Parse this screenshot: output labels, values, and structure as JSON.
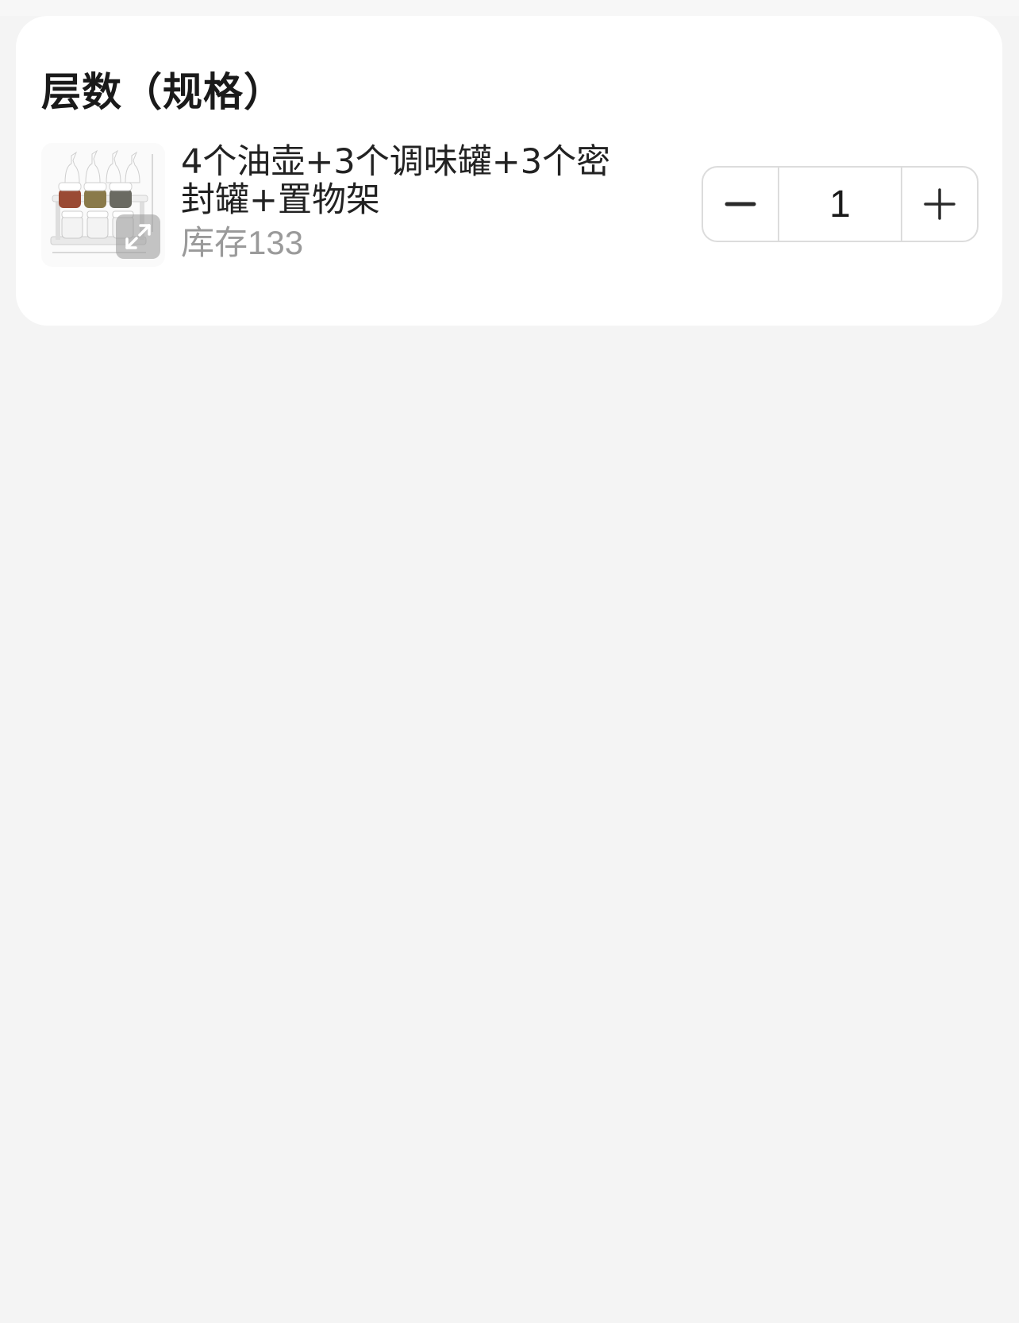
{
  "section": {
    "title": "层数（规格）"
  },
  "sku": {
    "name": "4个油壶+3个调味罐+3个密封罐+置物架",
    "stock_label": "库存",
    "stock_count": "133",
    "image_icon": "product-thumbnail",
    "expand_icon": "expand-arrows-icon"
  },
  "stepper": {
    "decrement_icon": "minus-icon",
    "value": "1",
    "increment_icon": "plus-icon"
  },
  "colors": {
    "background": "#f4f4f4",
    "card": "#ffffff",
    "text_primary": "#222222",
    "text_secondary": "#9a9a9a",
    "border": "#dcdcdc"
  }
}
